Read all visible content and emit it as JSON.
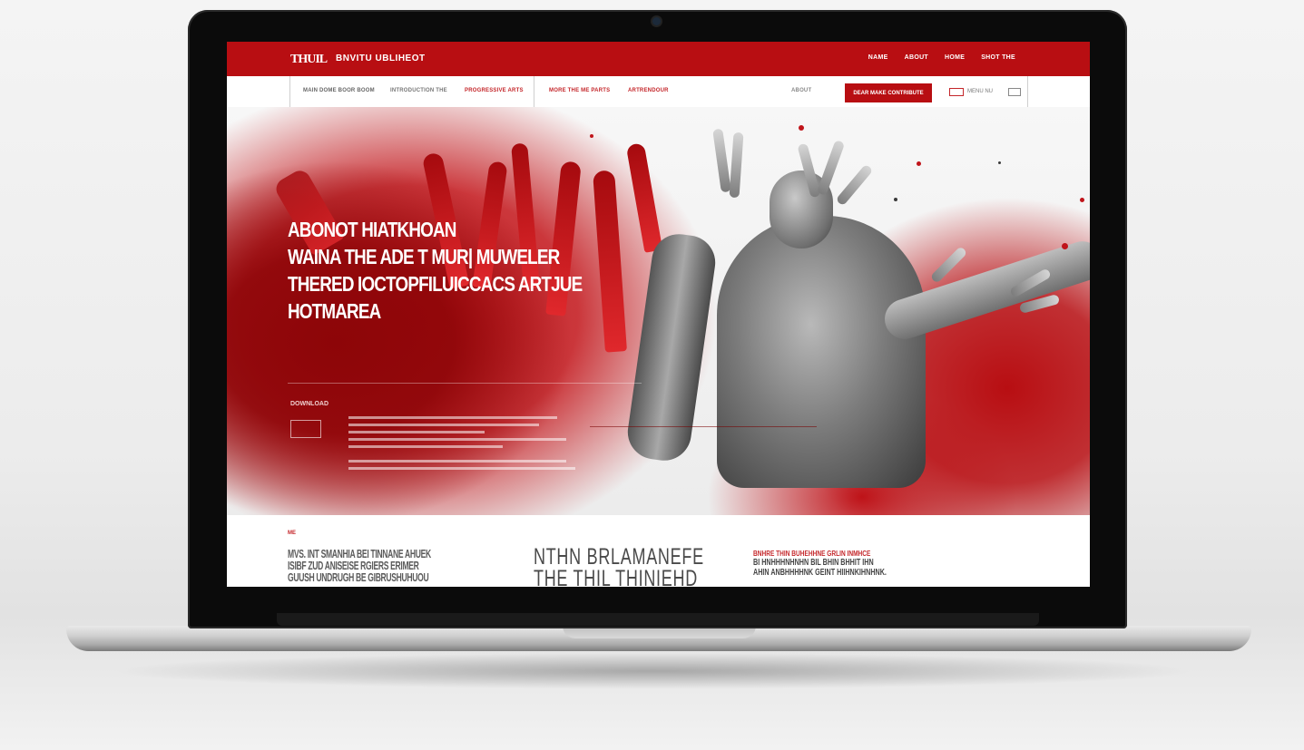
{
  "site": {
    "brand_mark": "THUIL",
    "brand_name": "BNVITU UBLIHEOT",
    "top_links": [
      "NAME",
      "ABOUT",
      "HOME",
      "SHOT THE"
    ],
    "nav_items": [
      "MAIN DOME BOOR BOOM",
      "INTRODUCTION THE",
      "PROGRESSIVE ARTS",
      "MORE THE ME PARTS",
      "ARTRENDOUR"
    ],
    "nav_right_link": "ABOUT",
    "nav_cta": "DEAR MAKE CONTRIBUTE",
    "nav_search_label": "MENU NU"
  },
  "hero": {
    "headline": [
      "ABONOT HIATKHOAN",
      "WAINA THE ADE T MUR| MUWELER",
      "THERED IOCTOPFILUICCACS ARTJUE",
      "HOTMAREA"
    ],
    "label": "DOWNLOAD"
  },
  "lower": {
    "tag": "ME",
    "left_lines": [
      "MVS. INT SMANHIA BEI TINNANE AHUEK",
      "ISIBF ZUD ANISEISE RGIERS ERIMER",
      "GUUSH UNDRUGH BE GIBRUSHUHUOU"
    ],
    "mid_lines": [
      "NTHN BRLAMANEFE",
      "THE THIL THINIEHD"
    ],
    "right_lines": [
      "BNHRE THIN BUHEHHNE GRLIN INMHCE",
      "BI HNHHHNHNHN BIL BHIN BHHIT IHN",
      "AHIN ANBHHHHNK GEINT HIIHNKIHNHNK."
    ]
  },
  "colors": {
    "brand_red": "#b80e12",
    "accent_red": "#c4262a",
    "laptop_bezel": "#0b0b0b",
    "laptop_silver": "#cfcfcf"
  }
}
